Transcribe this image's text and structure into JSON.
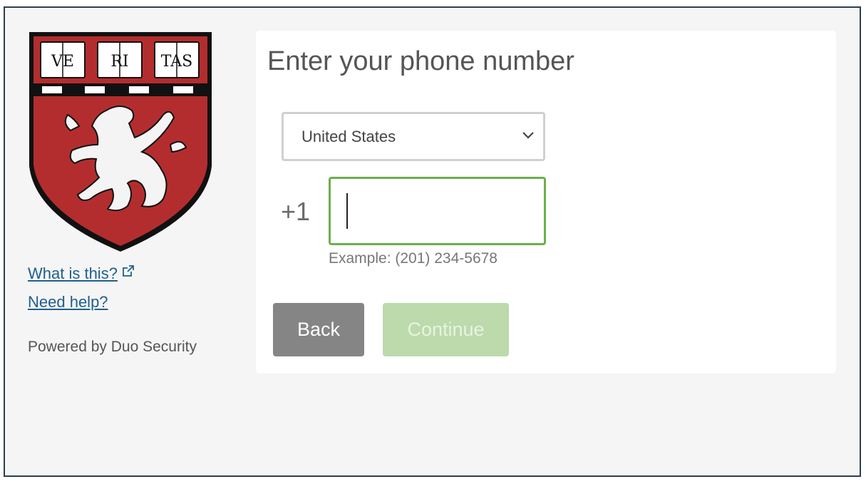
{
  "sidebar": {
    "logo_name": "harvard-shield",
    "logo_text": [
      "VE",
      "RI",
      "TAS"
    ],
    "links": {
      "what_is_this": "What is this?",
      "need_help": "Need help?"
    },
    "powered_by": "Powered by Duo Security"
  },
  "card": {
    "title": "Enter your phone number",
    "country_select": {
      "selected": "United States"
    },
    "phone": {
      "prefix": "+1",
      "value": "",
      "example": "Example: (201) 234-5678"
    },
    "buttons": {
      "back": "Back",
      "continue": "Continue"
    }
  },
  "colors": {
    "shield_red": "#b32d2e",
    "link_blue": "#1f5f8b",
    "input_focus_green": "#6ab04c",
    "continue_disabled": "#bcdaac",
    "back_gray": "#858585"
  }
}
